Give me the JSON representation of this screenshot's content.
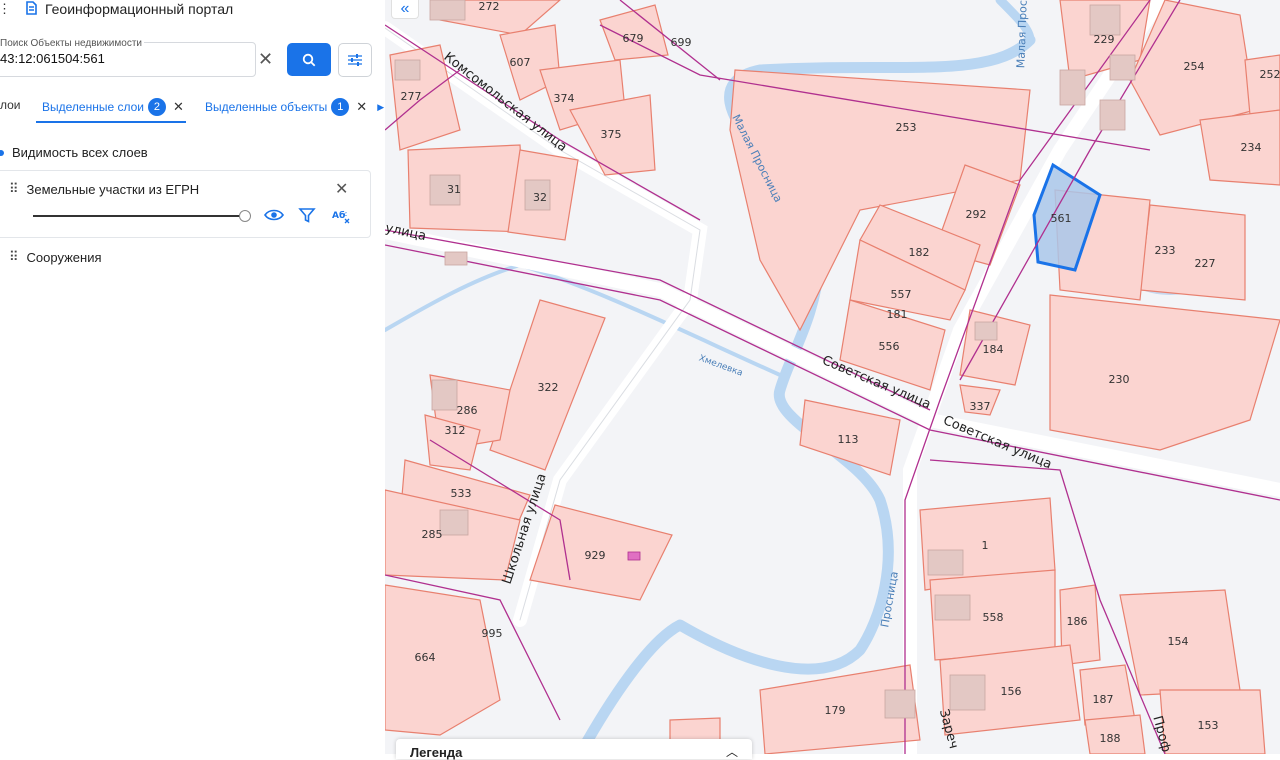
{
  "app": {
    "title": "Геоинформационный портал"
  },
  "search": {
    "label": "Поиск Объекты недвижимости",
    "value": "43:12:061504:561"
  },
  "tabs": [
    {
      "label": "лои"
    },
    {
      "label": "Выделенные слои",
      "count": "2"
    },
    {
      "label": "Выделенные объекты",
      "count": "1"
    }
  ],
  "layers": {
    "visibility_label": "Видимость всех слоев",
    "items": [
      {
        "label": "Земельные участки из ЕГРН"
      },
      {
        "label": "Сооружения"
      }
    ]
  },
  "legend": {
    "label": "Легенда"
  },
  "colors": {
    "accent": "#1a73e8",
    "parcel_fill": "#fbd4d0",
    "parcel_stroke": "#e8806f",
    "selected": "#1a73e8",
    "boundary": "#b0308f",
    "water": "#b9d6f2"
  },
  "map": {
    "streets": [
      "Комсомольская улица",
      "улица",
      "Советская улица",
      "Советская улица",
      "Школьная улица",
      "Зареч",
      "Проф"
    ],
    "water": [
      "Малая Просница",
      "Малая Просница",
      "Хмелевка",
      "Просница"
    ],
    "parcels": [
      "272",
      "607",
      "374",
      "375",
      "277",
      "679",
      "699",
      "229",
      "254",
      "252",
      "253",
      "234",
      "31",
      "32",
      "292",
      "561",
      "182",
      "233",
      "227",
      "557",
      "181",
      "556",
      "184",
      "230",
      "337",
      "322",
      "286",
      "312",
      "113",
      "533",
      "285",
      "929",
      "1",
      "558",
      "186",
      "154",
      "664",
      "995",
      "156",
      "187",
      "179",
      "188",
      "153"
    ]
  }
}
